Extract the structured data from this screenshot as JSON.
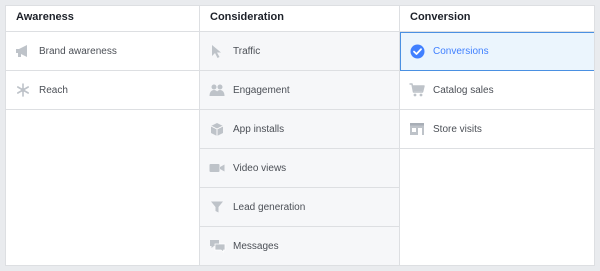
{
  "columns": [
    {
      "header": "Awareness",
      "items": [
        {
          "label": "Brand awareness",
          "icon": "megaphone-icon"
        },
        {
          "label": "Reach",
          "icon": "snowflake-icon"
        }
      ]
    },
    {
      "header": "Consideration",
      "items": [
        {
          "label": "Traffic",
          "icon": "cursor-icon"
        },
        {
          "label": "Engagement",
          "icon": "people-icon"
        },
        {
          "label": "App installs",
          "icon": "box-icon"
        },
        {
          "label": "Video views",
          "icon": "video-camera-icon"
        },
        {
          "label": "Lead generation",
          "icon": "funnel-icon"
        },
        {
          "label": "Messages",
          "icon": "chat-bubbles-icon"
        }
      ]
    },
    {
      "header": "Conversion",
      "items": [
        {
          "label": "Conversions",
          "icon": "checkmark-circle-icon",
          "selected": true
        },
        {
          "label": "Catalog sales",
          "icon": "shopping-cart-icon"
        },
        {
          "label": "Store visits",
          "icon": "store-icon"
        }
      ]
    }
  ],
  "colors": {
    "icon": "#bec3c9",
    "selected_accent": "#4080ff",
    "selected_bg": "#ebf5fd"
  }
}
